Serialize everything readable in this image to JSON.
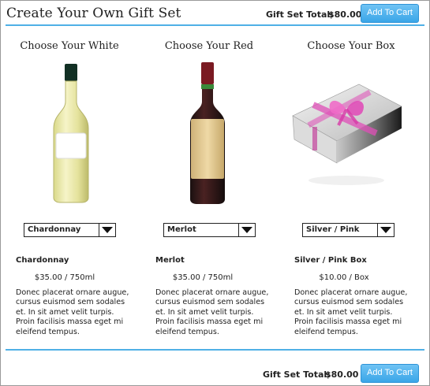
{
  "header": {
    "title": "Create Your Own Gift Set",
    "total_label": "Gift Set Total:",
    "total_value": "$80.00",
    "add_to_cart": "Add To Cart"
  },
  "columns": [
    {
      "title": "Choose Your White",
      "image": "white-wine-bottle",
      "select_value": "Chardonnay",
      "name": "Chardonnay",
      "price": "$35.00 / 750ml",
      "description": "Donec placerat ornare augue, cursus euismod sem sodales et. In sit amet velit turpis. Proin facilisis massa eget mi eleifend tempus."
    },
    {
      "title": "Choose Your Red",
      "image": "red-wine-bottle",
      "select_value": "Merlot",
      "name": "Merlot",
      "price": "$35.00 / 750ml",
      "description": "Donec placerat ornare augue, cursus euismod sem sodales et. In sit amet velit turpis. Proin facilisis massa eget mi eleifend tempus."
    },
    {
      "title": "Choose Your Box",
      "image": "gift-box",
      "select_value": "Silver / Pink",
      "name": "Silver / Pink Box",
      "price": "$10.00 / Box",
      "description": "Donec placerat ornare augue, cursus euismod sem sodales et. In sit amet velit turpis. Proin facilisis massa eget mi eleifend tempus."
    }
  ],
  "footer": {
    "total_label": "Gift Set Total:",
    "total_value": "$80.00",
    "add_to_cart": "Add To Cart"
  },
  "colors": {
    "accent": "#4fb0e6",
    "button": "#3aa6e8",
    "box_ribbon": "#e04fb8"
  }
}
